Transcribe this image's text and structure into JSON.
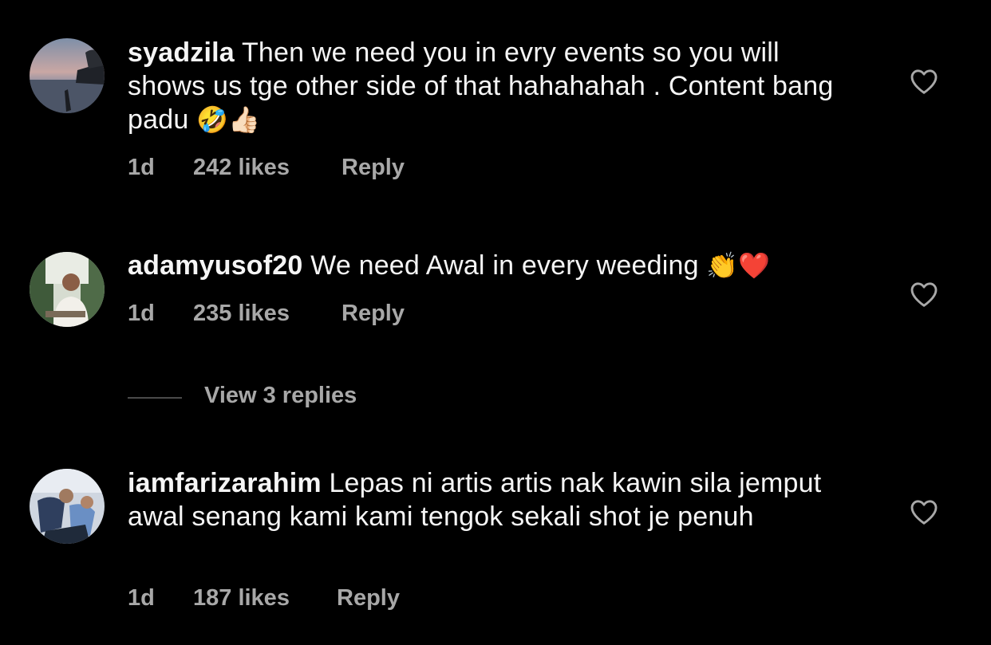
{
  "comments": [
    {
      "username": "syadzila",
      "text": " Then we need you in evry events so you will shows us tge other side of that  hahahahah . Content bang padu ",
      "emoji": "🤣👍🏻",
      "time": "1d",
      "likes": "242 likes",
      "reply": "Reply"
    },
    {
      "username": "adamyusof20",
      "text": " We need Awal in every weeding ",
      "emoji": "👏❤️",
      "time": "1d",
      "likes": "235 likes",
      "reply": "Reply"
    },
    {
      "username": "iamfarizarahim",
      "text": " Lepas ni artis artis nak kawin sila jemput awal senang kami kami tengok sekali shot je penuh",
      "emoji": "",
      "time": "1d",
      "likes": "187 likes",
      "reply": "Reply"
    }
  ],
  "view_replies": "View 3 replies",
  "colors": {
    "background": "#000000",
    "text": "#f5f5f5",
    "muted": "#a8a8a8"
  },
  "icons": {
    "like": "heart-outline-icon"
  }
}
